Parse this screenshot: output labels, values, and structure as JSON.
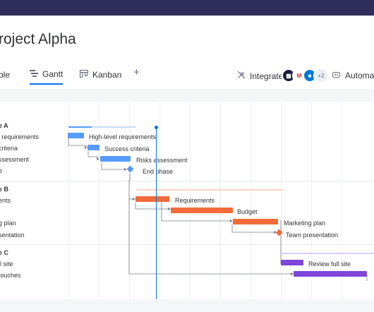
{
  "board": {
    "title": "roject Alpha"
  },
  "tabs": [
    {
      "label": "ble",
      "icon": "table-icon"
    },
    {
      "label": "Gantt",
      "icon": "gantt-icon",
      "active": true
    },
    {
      "label": "Kanban",
      "icon": "kanban-icon"
    }
  ],
  "toolbar": {
    "integrate_label": "Integrate",
    "apps_more": "+2",
    "automate_label": "Automate"
  },
  "colors": {
    "phaseA": "#579bfc",
    "phaseB": "#f26b3a",
    "phaseC": "#7e47d9",
    "today": "#0073ea",
    "topbar": "#2f2d5a"
  },
  "groups": [
    {
      "label": "e A",
      "rows": [
        {
          "label": "l requirements",
          "bar_label": "High-level requirements"
        },
        {
          "label": "criteria",
          "bar_label": "Success criteria"
        },
        {
          "label": "ssessment",
          "bar_label": "Risks assessment"
        },
        {
          "label": "e",
          "bar_label": "End phase"
        }
      ]
    },
    {
      "label": "e B",
      "rows": [
        {
          "label": "ents",
          "bar_label": "Requirements"
        },
        {
          "label": "",
          "bar_label": "Budget"
        },
        {
          "label": "g plan",
          "bar_label": "Marketing plan"
        },
        {
          "label": "sentation",
          "bar_label": "Team presentation"
        }
      ]
    },
    {
      "label": "e C",
      "rows": [
        {
          "label": "ll site",
          "bar_label": "Review full site"
        },
        {
          "label": "touches",
          "bar_label": ""
        }
      ]
    }
  ]
}
